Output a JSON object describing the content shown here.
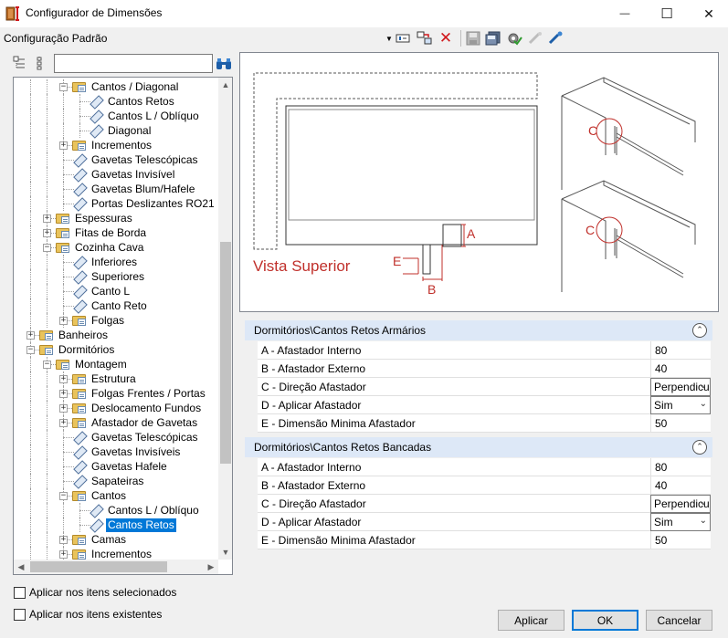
{
  "window": {
    "title": "Configurador de Dimensões",
    "minimize_glyph": "—",
    "maximize_glyph": "☐",
    "close_glyph": "✕"
  },
  "toolbar": {
    "config_label": "Configuração Padrão",
    "icons": [
      "dropdown-arrow-icon",
      "edit-icon",
      "move-icon",
      "delete-icon",
      "save-icon",
      "save-all-icon",
      "settings-check-icon",
      "tool-disabled-icon",
      "tool-icon"
    ],
    "delete_color": "#d0181c"
  },
  "tree_search": {
    "value": "",
    "placeholder": ""
  },
  "tree": {
    "nodes": [
      {
        "label": "Cantos / Diagonal",
        "level": 3,
        "type": "folder",
        "expander": "-"
      },
      {
        "label": "Cantos Retos",
        "level": 4,
        "type": "leaf"
      },
      {
        "label": "Cantos L / Oblíquo",
        "level": 4,
        "type": "leaf"
      },
      {
        "label": "Diagonal",
        "level": 4,
        "type": "leaf"
      },
      {
        "label": "Incrementos",
        "level": 3,
        "type": "folder",
        "expander": "+"
      },
      {
        "label": "Gavetas Telescópicas",
        "level": 3,
        "type": "leaf"
      },
      {
        "label": "Gavetas Invisível",
        "level": 3,
        "type": "leaf"
      },
      {
        "label": "Gavetas Blum/Hafele",
        "level": 3,
        "type": "leaf"
      },
      {
        "label": "Portas Deslizantes RO21",
        "level": 3,
        "type": "leaf"
      },
      {
        "label": "Espessuras",
        "level": 2,
        "type": "folder",
        "expander": "+"
      },
      {
        "label": "Fitas de Borda",
        "level": 2,
        "type": "folder",
        "expander": "+"
      },
      {
        "label": "Cozinha Cava",
        "level": 2,
        "type": "folder",
        "expander": "-"
      },
      {
        "label": "Inferiores",
        "level": 3,
        "type": "leaf"
      },
      {
        "label": "Superiores",
        "level": 3,
        "type": "leaf"
      },
      {
        "label": "Canto L",
        "level": 3,
        "type": "leaf"
      },
      {
        "label": "Canto Reto",
        "level": 3,
        "type": "leaf"
      },
      {
        "label": "Folgas",
        "level": 3,
        "type": "folder",
        "expander": "+"
      },
      {
        "label": "Banheiros",
        "level": 1,
        "type": "folder",
        "expander": "+"
      },
      {
        "label": "Dormitórios",
        "level": 1,
        "type": "folder",
        "expander": "-"
      },
      {
        "label": "Montagem",
        "level": 2,
        "type": "folder",
        "expander": "-"
      },
      {
        "label": "Estrutura",
        "level": 3,
        "type": "folder",
        "expander": "+"
      },
      {
        "label": "Folgas Frentes / Portas",
        "level": 3,
        "type": "folder",
        "expander": "+"
      },
      {
        "label": "Deslocamento Fundos",
        "level": 3,
        "type": "folder",
        "expander": "+"
      },
      {
        "label": "Afastador de Gavetas",
        "level": 3,
        "type": "folder",
        "expander": "+"
      },
      {
        "label": "Gavetas Telescópicas",
        "level": 3,
        "type": "leaf"
      },
      {
        "label": "Gavetas Invisíveis",
        "level": 3,
        "type": "leaf"
      },
      {
        "label": "Gavetas Hafele",
        "level": 3,
        "type": "leaf"
      },
      {
        "label": "Sapateiras",
        "level": 3,
        "type": "leaf"
      },
      {
        "label": "Cantos",
        "level": 3,
        "type": "folder",
        "expander": "-"
      },
      {
        "label": "Cantos L / Oblíquo",
        "level": 4,
        "type": "leaf"
      },
      {
        "label": "Cantos Retos",
        "level": 4,
        "type": "leaf",
        "selected": true
      },
      {
        "label": "Camas",
        "level": 3,
        "type": "folder",
        "expander": "+"
      },
      {
        "label": "Incrementos",
        "level": 3,
        "type": "folder",
        "expander": "+"
      }
    ]
  },
  "preview": {
    "view_label": "Vista Superior",
    "label_a": "A",
    "label_b": "B",
    "label_e": "E",
    "label_c": "C",
    "label_c2": "C",
    "accent": "#c0302b"
  },
  "groups": [
    {
      "title": "Dormitórios\\Cantos Retos Armários",
      "rows": [
        {
          "name": "A - Afastador Interno",
          "value": "80",
          "kind": "text"
        },
        {
          "name": "B - Afastador Externo",
          "value": "40",
          "kind": "text"
        },
        {
          "name": "C - Direção Afastador",
          "value": "Perpendicular",
          "kind": "select"
        },
        {
          "name": "D - Aplicar Afastador",
          "value": "Sim",
          "kind": "select"
        },
        {
          "name": "E - Dimensão Minima Afastador",
          "value": "50",
          "kind": "text"
        }
      ]
    },
    {
      "title": "Dormitórios\\Cantos Retos Bancadas",
      "rows": [
        {
          "name": "A - Afastador Interno",
          "value": "80",
          "kind": "text"
        },
        {
          "name": "B - Afastador Externo",
          "value": "40",
          "kind": "text"
        },
        {
          "name": "C - Direção Afastador",
          "value": "Perpendicular",
          "kind": "select"
        },
        {
          "name": "D - Aplicar Afastador",
          "value": "Sim",
          "kind": "select"
        },
        {
          "name": "E - Dimensão Minima Afastador",
          "value": "50",
          "kind": "text"
        }
      ]
    }
  ],
  "options": {
    "apply_selected": "Aplicar nos itens selecionados",
    "apply_existing": "Aplicar nos itens existentes"
  },
  "buttons": {
    "apply": "Aplicar",
    "ok": "OK",
    "cancel": "Cancelar"
  }
}
